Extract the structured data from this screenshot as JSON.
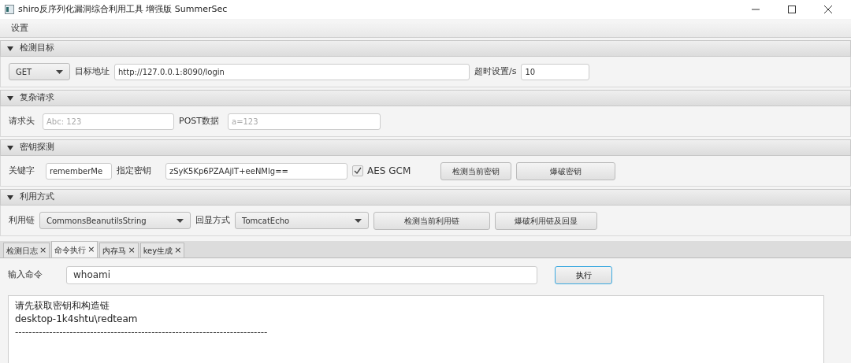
{
  "window": {
    "title": "shiro反序列化漏洞综合利用工具 增强版 SummerSec"
  },
  "menu": [
    "设置"
  ],
  "sections": [
    {
      "title": "检测目标",
      "expanded": true,
      "items": [
        {
          "kind": "dropdown",
          "value": "GET"
        },
        {
          "kind": "label",
          "text": "目标地址"
        },
        {
          "kind": "input",
          "value": "http://127.0.0.1:8090/login"
        },
        {
          "kind": "label",
          "text": "超时设置/s"
        },
        {
          "kind": "input",
          "value": "10"
        }
      ]
    },
    {
      "title": "复杂请求",
      "expanded": true,
      "items": [
        {
          "kind": "label",
          "text": "请求头"
        },
        {
          "kind": "input",
          "placeholder": "Abc: 123"
        },
        {
          "kind": "label",
          "text": "POST数据"
        },
        {
          "kind": "input",
          "placeholder": "a=123"
        }
      ]
    },
    {
      "title": "密钥探测",
      "expanded": true,
      "items": [
        {
          "kind": "label",
          "text": "关键字"
        },
        {
          "kind": "input",
          "value": "rememberMe"
        },
        {
          "kind": "label",
          "text": "指定密钥"
        },
        {
          "kind": "input",
          "value": "zSyK5Kp6PZAAjlT+eeNMlg=="
        },
        {
          "kind": "checkbox",
          "text": "AES GCM",
          "checked": true
        },
        {
          "kind": "button",
          "text": "检测当前密钥"
        },
        {
          "kind": "button",
          "text": "爆破密钥"
        }
      ]
    },
    {
      "title": "利用方式",
      "expanded": true,
      "items": [
        {
          "kind": "label",
          "text": "利用链"
        },
        {
          "kind": "dropdown",
          "value": "CommonsBeanutilsString"
        },
        {
          "kind": "label",
          "text": "回显方式"
        },
        {
          "kind": "dropdown",
          "value": "TomcatEcho"
        },
        {
          "kind": "button",
          "text": "检测当前利用链"
        },
        {
          "kind": "button",
          "text": "爆破利用链及回显"
        }
      ]
    }
  ],
  "tabs": [
    {
      "label": "检测日志",
      "close": "×",
      "selected": false
    },
    {
      "label": "命令执行",
      "close": "×",
      "selected": true
    },
    {
      "label": "内存马",
      "close": "×",
      "selected": false
    },
    {
      "label": "key生成",
      "close": "×",
      "selected": false
    }
  ],
  "command": {
    "label": "输入命令",
    "value": "whoami",
    "button": "执行"
  },
  "output": [
    "请先获取密钥和构造链",
    "desktop-1k4shtu\\redteam",
    "--------------------------------------------------------------------------"
  ]
}
